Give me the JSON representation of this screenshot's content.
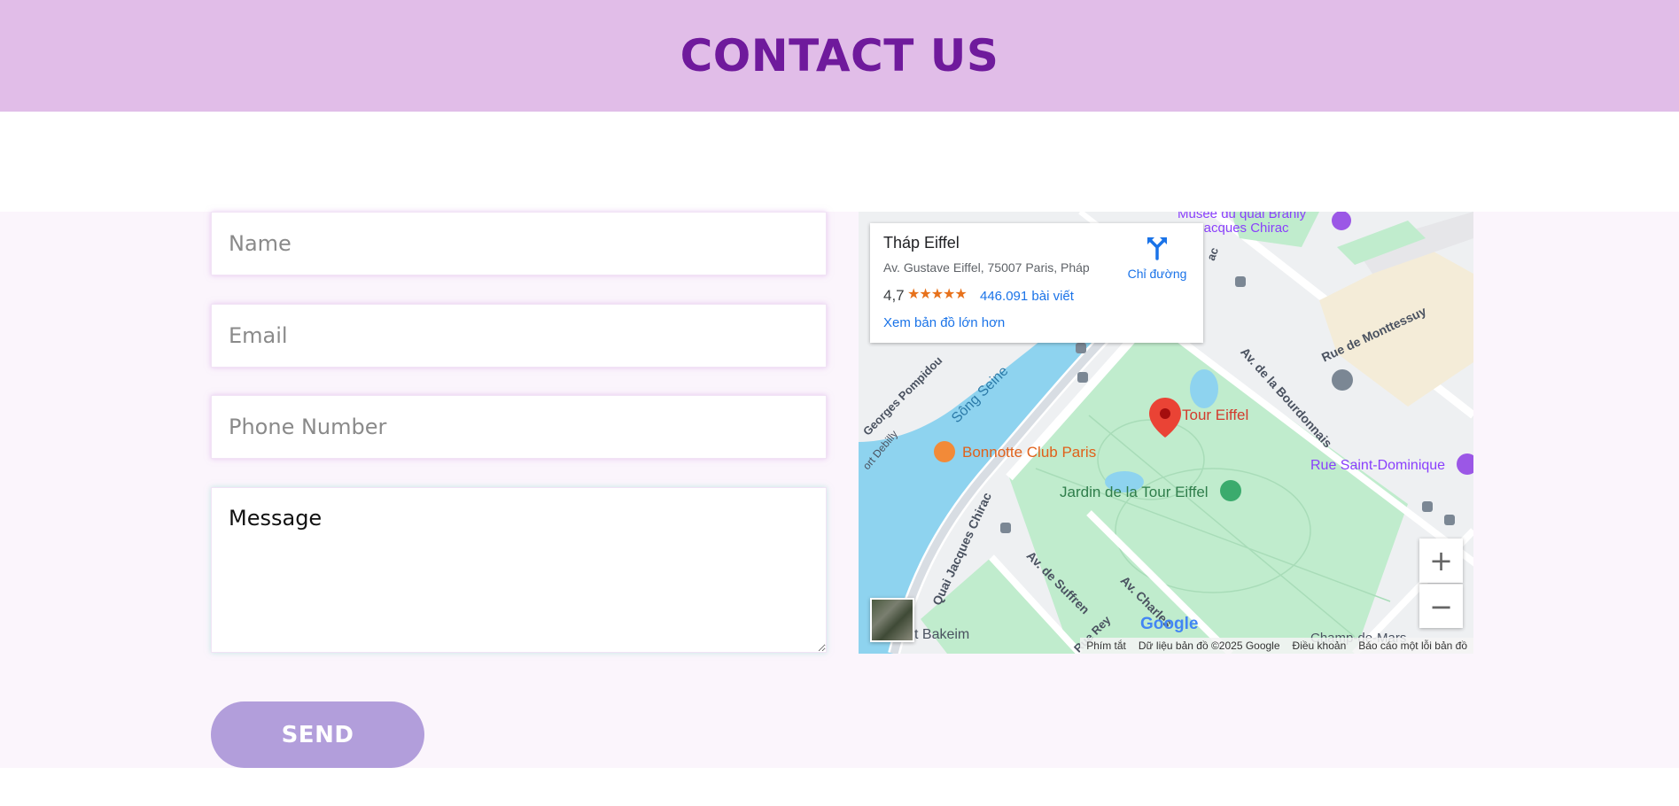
{
  "header": {
    "title": "CONTACT US"
  },
  "form": {
    "name_placeholder": "Name",
    "email_placeholder": "Email",
    "phone_placeholder": "Phone Number",
    "message_placeholder": "Message",
    "send_label": "SEND"
  },
  "map": {
    "place_title": "Tháp Eiffel",
    "place_address": "Av. Gustave Eiffel, 75007 Paris, Pháp",
    "rating": "4,7",
    "rating_stars": "★★★★★",
    "reviews_link": "446.091 bài viết",
    "larger_map_link": "Xem bản đồ lớn hơn",
    "directions_label": "Chỉ đường",
    "labels": {
      "musee": "Musée du quai Branly",
      "jacques": "- Jacques Chirac",
      "bourdonnais": "Av. de la Bourdonnais",
      "monttessuy": "Rue de Monttessuy",
      "seine": "Sông Seine",
      "pompidou": "Georges Pompidou",
      "debilly": "ort Debilly",
      "tour_eiffel": "Tour Eiffel",
      "bonnotte": "Bonnotte Club Paris",
      "st_dominique": "Rue Saint-Dominique",
      "jardin": "Jardin de la Tour Eiffel",
      "quai_chirac": "Quai Jacques Chirac",
      "suffren": "Av. de Suffren",
      "charles": "Av. Charles",
      "rey": "Rue Rey",
      "bakeim": "t Bakeim",
      "champ": "Champ-de-Mars",
      "chirac_top": "ac"
    },
    "zoom_in": "+",
    "zoom_out": "−",
    "google_logo": "Google",
    "footer": {
      "shortcuts": "Phím tắt",
      "map_data": "Dữ liệu bản đồ ©2025 Google",
      "terms": "Điều khoản",
      "report": "Báo cáo một lỗi bản đồ"
    },
    "colors": {
      "water": "#8ed3ef",
      "park": "#c0eccd",
      "pin": "#ea4335",
      "poi_orange": "#f28a38",
      "poi_purple": "#9b57e6"
    }
  }
}
